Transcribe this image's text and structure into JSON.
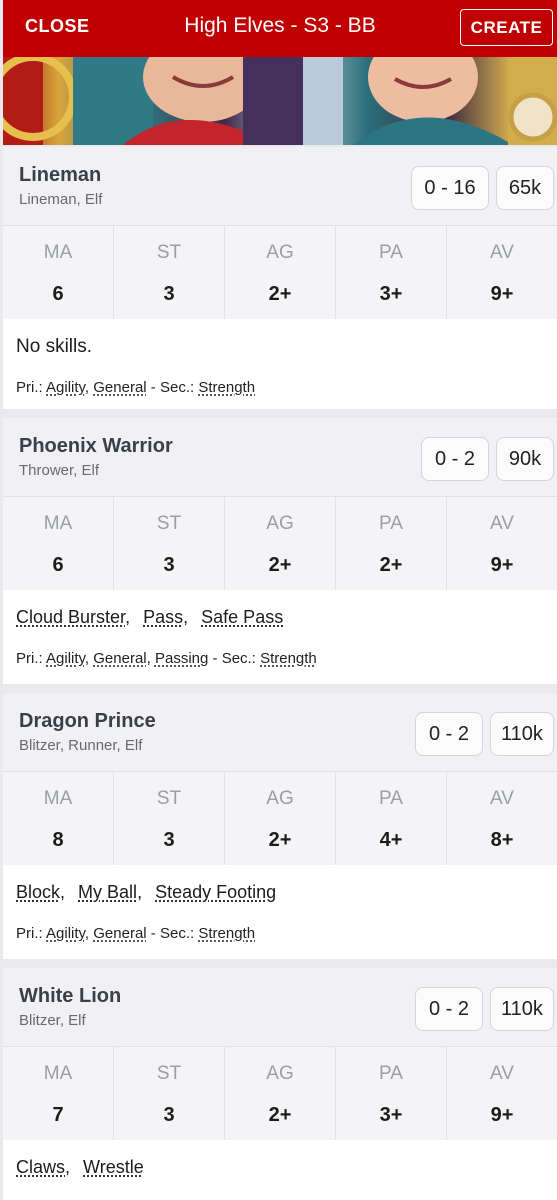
{
  "header": {
    "close_label": "CLOSE",
    "title": "High Elves - S3 - BB",
    "create_label": "CREATE",
    "bar_color": "#c00000"
  },
  "stat_labels": [
    "MA",
    "ST",
    "AG",
    "PA",
    "AV"
  ],
  "access_prefix_primary": "Pri.:",
  "access_prefix_secondary": "Sec.:",
  "players": [
    {
      "name": "Lineman",
      "positions": "Lineman, Elf",
      "quantity": "0 - 16",
      "cost": "65k",
      "stats": [
        "6",
        "3",
        "2+",
        "3+",
        "9+"
      ],
      "skills": [],
      "no_skills_text": "No skills.",
      "primary": [
        "Agility",
        "General"
      ],
      "secondary": [
        "Strength"
      ]
    },
    {
      "name": "Phoenix Warrior",
      "positions": "Thrower, Elf",
      "quantity": "0 - 2",
      "cost": "90k",
      "stats": [
        "6",
        "3",
        "2+",
        "2+",
        "9+"
      ],
      "skills": [
        "Cloud Burster",
        "Pass",
        "Safe Pass"
      ],
      "primary": [
        "Agility",
        "General",
        "Passing"
      ],
      "secondary": [
        "Strength"
      ]
    },
    {
      "name": "Dragon Prince",
      "positions": "Blitzer, Runner, Elf",
      "quantity": "0 - 2",
      "cost": "110k",
      "stats": [
        "8",
        "3",
        "2+",
        "4+",
        "8+"
      ],
      "skills": [
        "Block",
        "My Ball",
        "Steady Footing"
      ],
      "primary": [
        "Agility",
        "General"
      ],
      "secondary": [
        "Strength"
      ]
    },
    {
      "name": "White Lion",
      "positions": "Blitzer, Elf",
      "quantity": "0 - 2",
      "cost": "110k",
      "stats": [
        "7",
        "3",
        "2+",
        "3+",
        "9+"
      ],
      "skills": [
        "Claws",
        "Wrestle"
      ],
      "primary": [],
      "secondary": []
    }
  ]
}
